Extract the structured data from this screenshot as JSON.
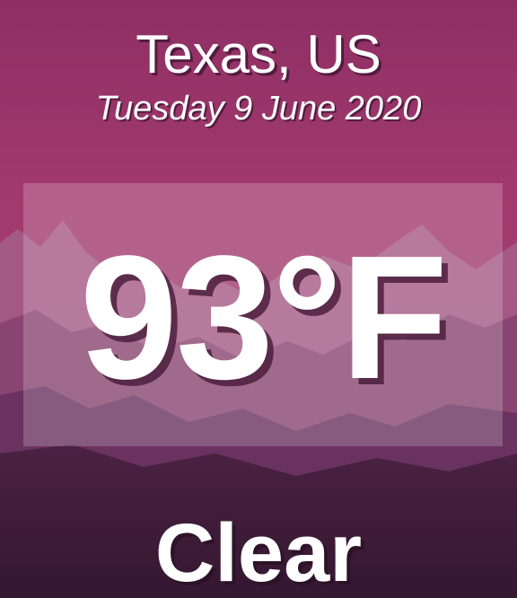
{
  "weather": {
    "location": "Texas, US",
    "date": "Tuesday 9 June 2020",
    "temperature": "93°F",
    "condition": "Clear"
  },
  "theme": {
    "sky_top": "#8c2f62",
    "sky_mid": "#a2386e",
    "mountain_far": "#a05a86",
    "mountain_mid": "#7f3d6e",
    "mountain_near": "#4e2343",
    "ground": "#3a1a32"
  },
  "background": {
    "scene": "mountain-landscape"
  }
}
